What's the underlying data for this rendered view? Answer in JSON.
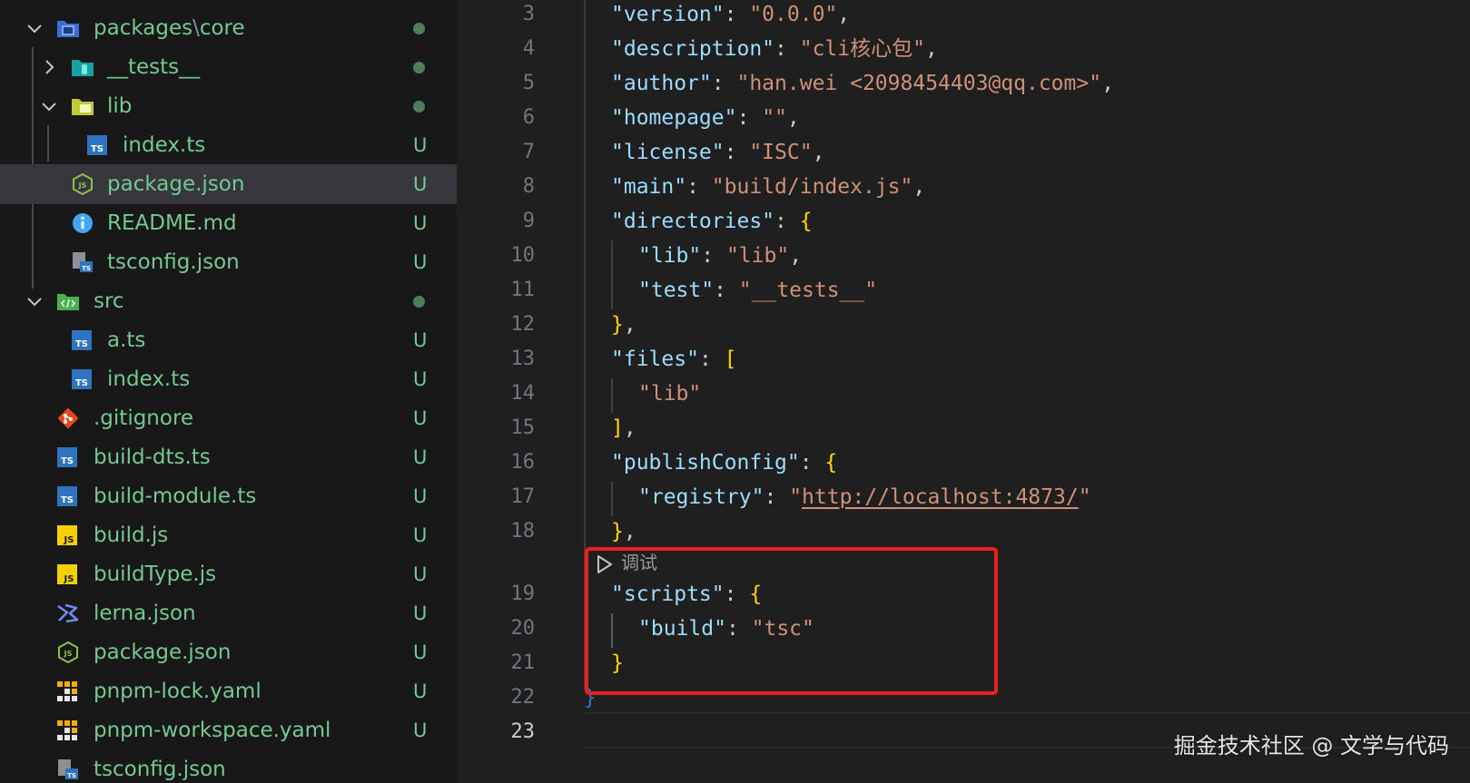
{
  "explorer": {
    "items": [
      {
        "label_parts": [
          "packages",
          "\\",
          "core"
        ],
        "status": "dot",
        "icon": "folder-packages-icon",
        "expanded": true
      },
      {
        "label": "__tests__",
        "status": "dot",
        "icon": "folder-tests-icon",
        "expanded": false
      },
      {
        "label": "lib",
        "status": "dot",
        "icon": "folder-lib-icon",
        "expanded": true
      },
      {
        "label": "index.ts",
        "status": "U",
        "icon": "typescript-file-icon"
      },
      {
        "label": "package.json",
        "status": "U",
        "icon": "package-json-icon"
      },
      {
        "label": "README.md",
        "status": "U",
        "icon": "readme-info-icon"
      },
      {
        "label": "tsconfig.json",
        "status": "U",
        "icon": "tsconfig-icon"
      },
      {
        "label": "src",
        "status": "dot",
        "icon": "folder-src-icon",
        "expanded": true
      },
      {
        "label": "a.ts",
        "status": "U",
        "icon": "typescript-file-icon"
      },
      {
        "label": "index.ts",
        "status": "U",
        "icon": "typescript-file-icon"
      },
      {
        "label": ".gitignore",
        "status": "U",
        "icon": "git-icon"
      },
      {
        "label": "build-dts.ts",
        "status": "U",
        "icon": "typescript-file-icon"
      },
      {
        "label": "build-module.ts",
        "status": "U",
        "icon": "typescript-file-icon"
      },
      {
        "label": "build.js",
        "status": "U",
        "icon": "javascript-file-icon"
      },
      {
        "label": "buildType.js",
        "status": "U",
        "icon": "javascript-file-icon"
      },
      {
        "label": "lerna.json",
        "status": "U",
        "icon": "lerna-icon"
      },
      {
        "label": "package.json",
        "status": "U",
        "icon": "package-json-icon"
      },
      {
        "label": "pnpm-lock.yaml",
        "status": "U",
        "icon": "pnpm-icon"
      },
      {
        "label": "pnpm-workspace.yaml",
        "status": "U",
        "icon": "pnpm-icon"
      },
      {
        "label": "tsconfig.json",
        "status": "",
        "icon": "tsconfig-icon"
      }
    ]
  },
  "editor": {
    "line_numbers": [
      "3",
      "4",
      "5",
      "6",
      "7",
      "8",
      "9",
      "10",
      "11",
      "12",
      "13",
      "14",
      "15",
      "16",
      "17",
      "18",
      "19",
      "20",
      "21",
      "22",
      "23"
    ],
    "active_line": "23",
    "codelens_label": "调试",
    "code": {
      "version_key": "\"version\"",
      "version_val": "\"0.0.0\"",
      "description_key": "\"description\"",
      "description_val": "\"cli核心包\"",
      "author_key": "\"author\"",
      "author_val": "\"han.wei <2098454403@qq.com>\"",
      "homepage_key": "\"homepage\"",
      "homepage_val": "\"\"",
      "license_key": "\"license\"",
      "license_val": "\"ISC\"",
      "main_key": "\"main\"",
      "main_val": "\"build/index.js\"",
      "directories_key": "\"directories\"",
      "lib_key": "\"lib\"",
      "lib_val": "\"lib\"",
      "test_key": "\"test\"",
      "test_val": "\"__tests__\"",
      "files_key": "\"files\"",
      "files_item": "\"lib\"",
      "publishConfig_key": "\"publishConfig\"",
      "registry_key": "\"registry\"",
      "registry_q1": "\"",
      "registry_url": "http://localhost:4873/",
      "registry_q2": "\"",
      "scripts_key": "\"scripts\"",
      "build_key": "\"build\"",
      "build_val": "\"tsc\""
    }
  },
  "watermark": "掘金技术社区 @ 文学与代码",
  "colors": {
    "sidebar_bg": "#181818",
    "editor_bg": "#1f1f1f",
    "git_untracked": "#73c991",
    "json_key": "#9cdcfe",
    "json_string": "#ce9178",
    "bracket": "#ffd700",
    "highlight_box": "#e8211c"
  }
}
